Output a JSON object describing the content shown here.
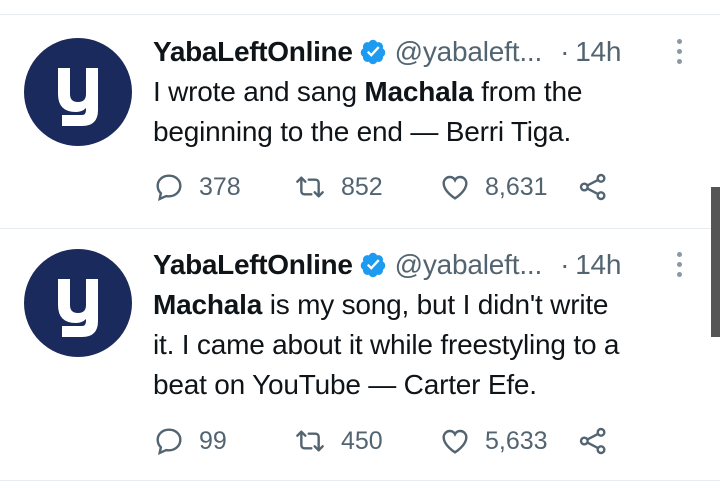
{
  "tweets": [
    {
      "author_name": "YabaLeftOnline",
      "handle": "@yabaleft...",
      "separator": "·",
      "time": "14h",
      "text_bold": "",
      "text_pre": "I wrote and sang ",
      "text_bold_word": "Machala",
      "text_post": " from the\nbeginning to the end — Berri Tiga.",
      "replies": "378",
      "retweets": "852",
      "likes": "8,631"
    },
    {
      "author_name": "YabaLeftOnline",
      "handle": "@yabaleft...",
      "separator": "·",
      "time": "14h",
      "text_pre": "",
      "text_bold_word": "Machala",
      "text_post": " is my song, but I didn't write\nit. I came about it while freestyling to a\nbeat on YouTube — Carter Efe.",
      "replies": "99",
      "retweets": "450",
      "likes": "5,633"
    }
  ],
  "avatar_letter": "y",
  "colors": {
    "avatar_bg": "#1b2a5c",
    "verified": "#1d9bf0",
    "secondary_text": "#536471",
    "icon": "#536471"
  },
  "icons": [
    "reply-icon",
    "retweet-icon",
    "like-icon",
    "share-icon",
    "verified-badge-icon",
    "more-icon"
  ]
}
